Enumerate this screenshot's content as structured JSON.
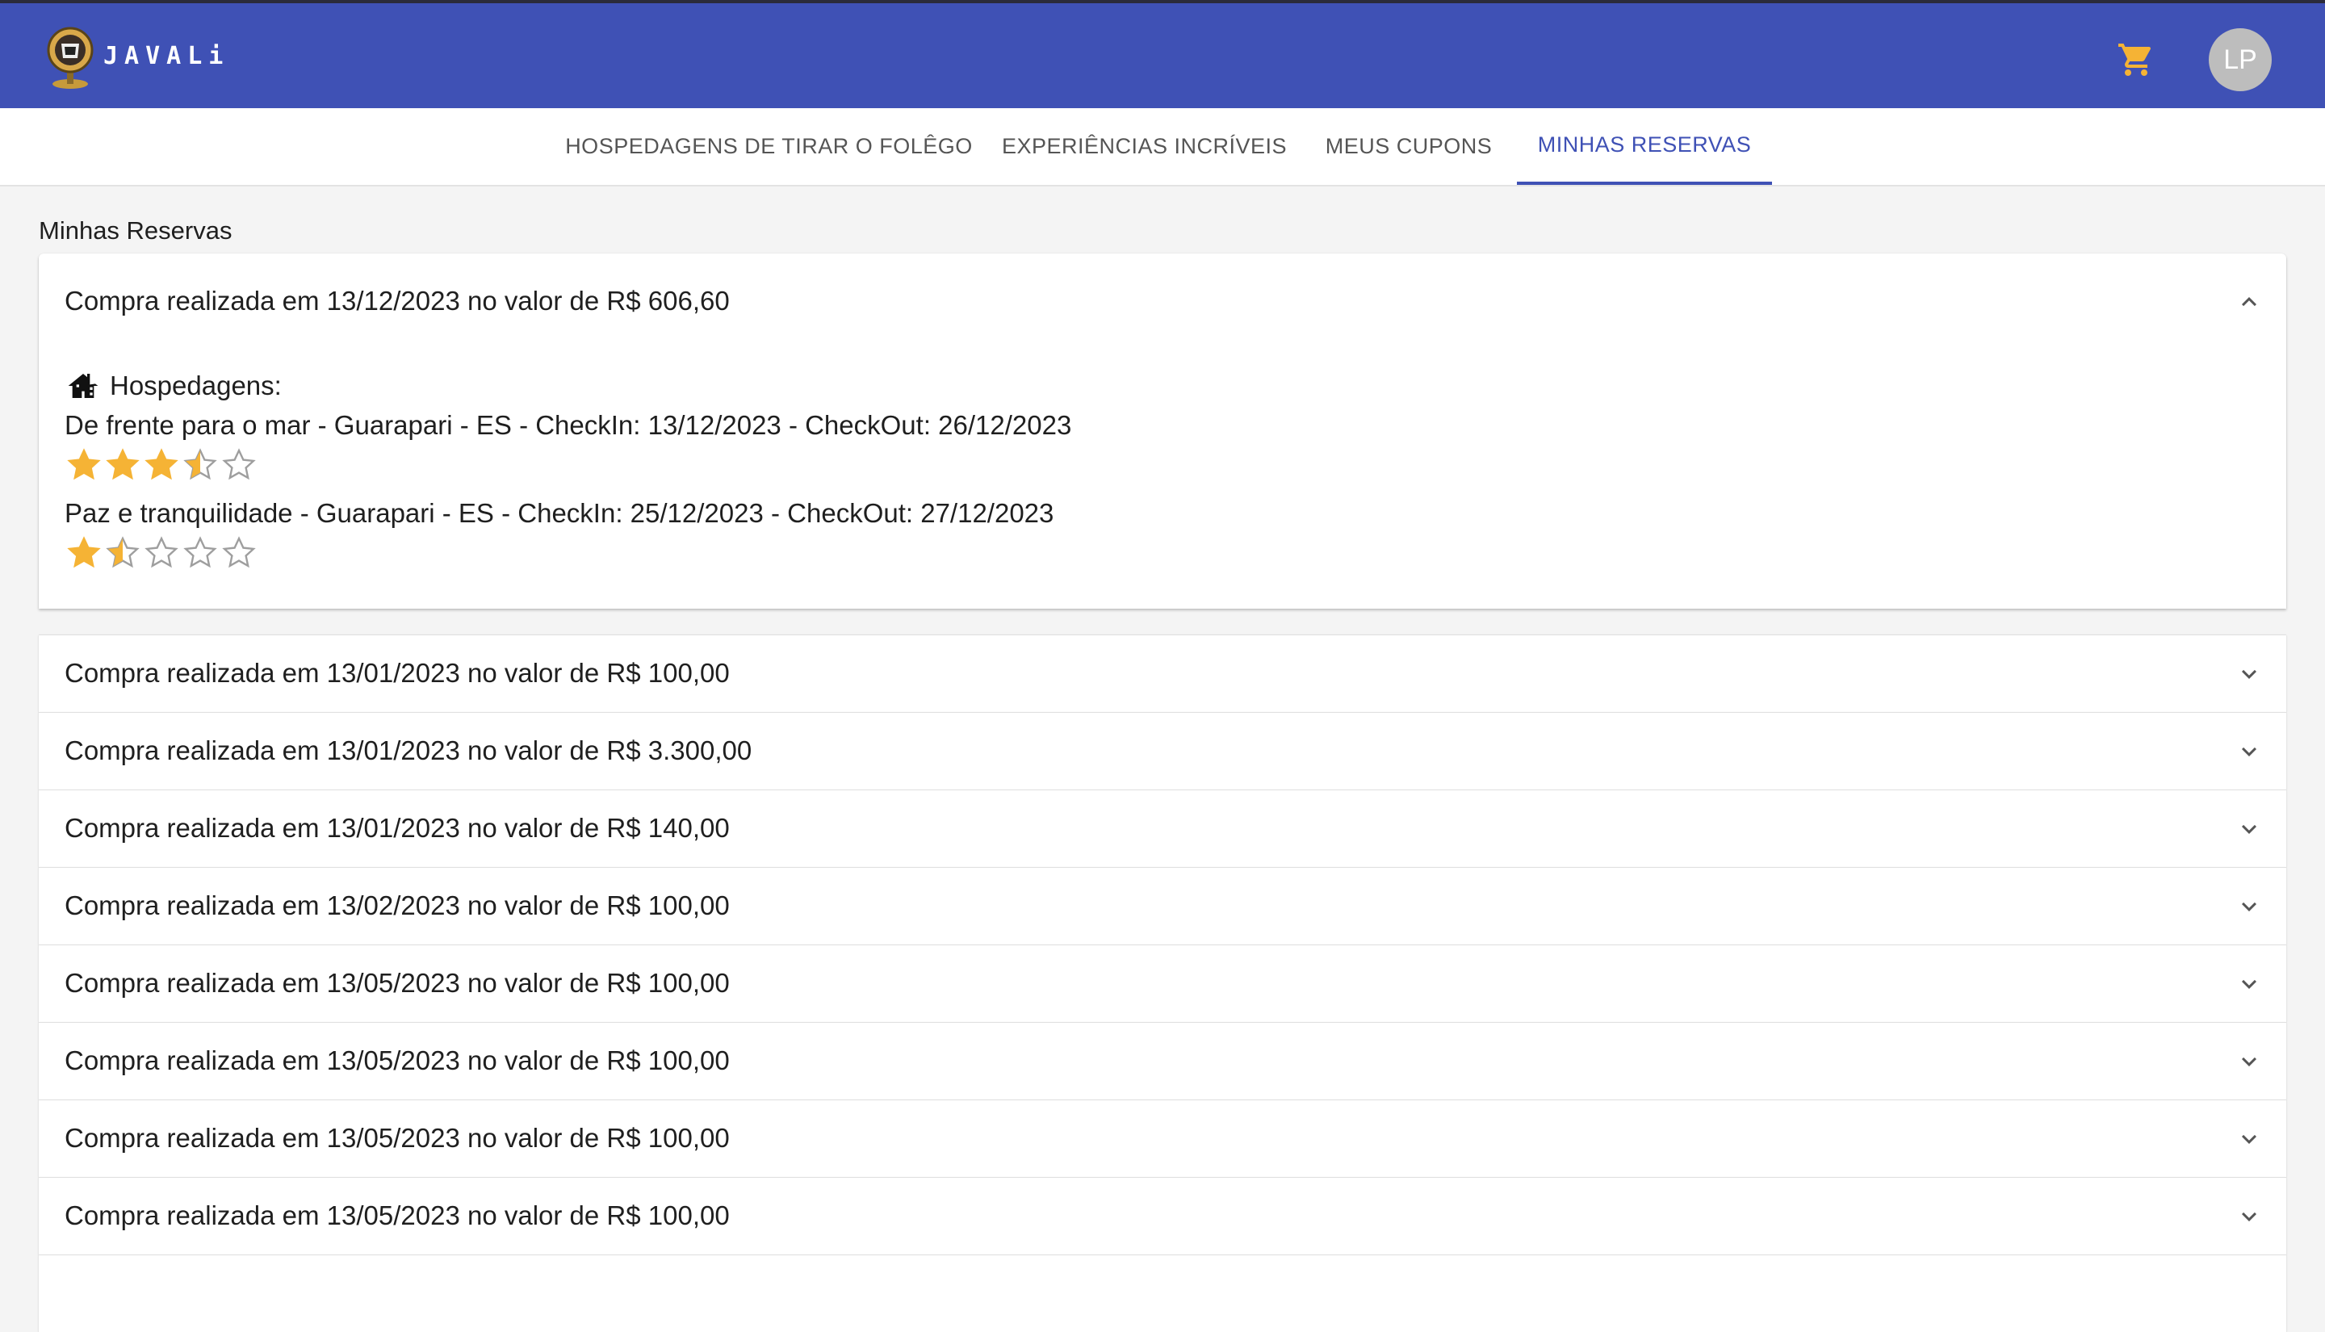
{
  "app": {
    "brand": "JAVALi",
    "avatar_initials": "LP",
    "cart_icon": "shopping-cart-icon",
    "accent": "#3f51b5",
    "star_color": "#f5b335"
  },
  "tabs": [
    {
      "label": "HOSPEDAGENS DE TIRAR O FOLÊGO",
      "active": false
    },
    {
      "label": "EXPERIÊNCIAS INCRÍVEIS",
      "active": false
    },
    {
      "label": "MEUS CUPONS",
      "active": false
    },
    {
      "label": "MINHAS RESERVAS",
      "active": true
    }
  ],
  "page": {
    "title": "Minhas Reservas"
  },
  "expanded": {
    "title": "Compra realizada em 13/12/2023 no valor de R$ 606,60",
    "hospedagens_label": "Hospedagens:",
    "stays": [
      {
        "text": "De frente para o mar - Guarapari - ES - CheckIn: 13/12/2023 - CheckOut: 26/12/2023",
        "rating": 3.5
      },
      {
        "text": "Paz e tranquilidade - Guarapari - ES - CheckIn: 25/12/2023 - CheckOut: 27/12/2023",
        "rating": 1.5
      }
    ]
  },
  "purchases": [
    "Compra realizada em 13/01/2023 no valor de R$ 100,00",
    "Compra realizada em 13/01/2023 no valor de R$ 3.300,00",
    "Compra realizada em 13/01/2023 no valor de R$ 140,00",
    "Compra realizada em 13/02/2023 no valor de R$ 100,00",
    "Compra realizada em 13/05/2023 no valor de R$ 100,00",
    "Compra realizada em 13/05/2023 no valor de R$ 100,00",
    "Compra realizada em 13/05/2023 no valor de R$ 100,00",
    "Compra realizada em 13/05/2023 no valor de R$ 100,00"
  ]
}
